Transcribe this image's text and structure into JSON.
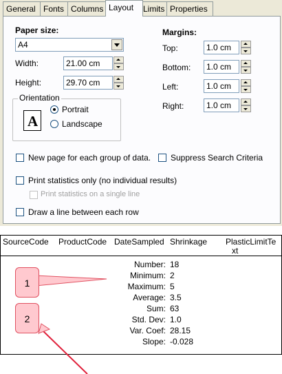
{
  "tabs": [
    {
      "label": "General"
    },
    {
      "label": "Fonts"
    },
    {
      "label": "Columns"
    },
    {
      "label": "Layout"
    },
    {
      "label": "Limits"
    },
    {
      "label": "Properties"
    }
  ],
  "paper": {
    "size_label": "Paper size:",
    "size_value": "A4",
    "width_label": "Width:",
    "width_value": "21.00 cm",
    "height_label": "Height:",
    "height_value": "29.70 cm"
  },
  "orientation": {
    "label": "Orientation",
    "icon_letter": "A",
    "portrait": "Portrait",
    "landscape": "Landscape",
    "selected": "Portrait"
  },
  "margins": {
    "label": "Margins:",
    "top_label": "Top:",
    "top_value": "1.0 cm",
    "bottom_label": "Bottom:",
    "bottom_value": "1.0 cm",
    "left_label": "Left:",
    "left_value": "1.0 cm",
    "right_label": "Right:",
    "right_value": "1.0 cm"
  },
  "options": {
    "new_page": "New page for each group of data.",
    "suppress": "Suppress Search Criteria",
    "stats_only": "Print statistics only (no individual results)",
    "stats_single": "Print statistics on a single line",
    "draw_line": "Draw a line between each row"
  },
  "report": {
    "columns": [
      "SourceCode",
      "ProductCode",
      "DateSampled",
      "Shrinkage",
      "PlasticLimitTe",
      "xt"
    ],
    "stats": [
      {
        "label": "Number:",
        "value": "18"
      },
      {
        "label": "Minimum:",
        "value": "2"
      },
      {
        "label": "Maximum:",
        "value": "5"
      },
      {
        "label": "Average:",
        "value": "3.5"
      },
      {
        "label": "Sum:",
        "value": "63"
      },
      {
        "label": "Std. Dev:",
        "value": "1.0"
      },
      {
        "label": "Var. Coef:",
        "value": "28.15"
      },
      {
        "label": "Slope:",
        "value": "-0.028"
      }
    ]
  },
  "callouts": [
    {
      "label": "1"
    },
    {
      "label": "2"
    }
  ],
  "colors": {
    "dialog_bg": "#ece9d8",
    "panel_bg": "#fcfcfe",
    "callout_fill": "#ffc9cf",
    "callout_border": "#e05060",
    "arrow": "#e0203a"
  }
}
